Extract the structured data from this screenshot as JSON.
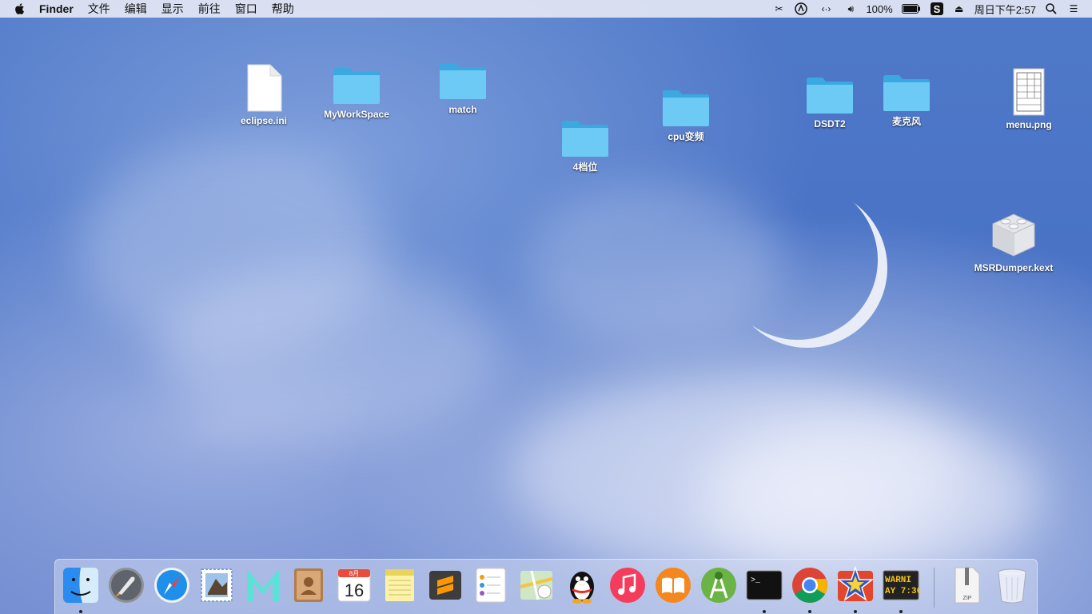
{
  "menubar": {
    "app_name": "Finder",
    "menus": [
      "文件",
      "编辑",
      "显示",
      "前往",
      "窗口",
      "帮助"
    ],
    "battery_percent": "100%",
    "datetime": "周日下午2:57",
    "status_icons": [
      "scissors-icon",
      "adobe-icon",
      "network-arrows-icon",
      "volume-icon",
      "battery-icon",
      "sogou-input-icon",
      "eject-icon",
      "spotlight-search-icon",
      "notification-center-icon"
    ]
  },
  "desktop": {
    "icons": [
      {
        "name": "eclipse.ini",
        "kind": "document"
      },
      {
        "name": "MyWorkSpace",
        "kind": "folder"
      },
      {
        "name": "match",
        "kind": "folder"
      },
      {
        "name": "4档位",
        "kind": "folder"
      },
      {
        "name": "cpu变频",
        "kind": "folder"
      },
      {
        "name": "DSDT2",
        "kind": "folder"
      },
      {
        "name": "麦克风",
        "kind": "folder"
      },
      {
        "name": "menu.png",
        "kind": "image"
      },
      {
        "name": "MSRDumper.kext",
        "kind": "kext"
      }
    ]
  },
  "dock": {
    "apps": [
      {
        "name": "Finder",
        "icon": "finder-icon",
        "running": true
      },
      {
        "name": "Launchpad",
        "icon": "rocket-icon",
        "running": false
      },
      {
        "name": "Safari",
        "icon": "compass-icon",
        "running": false
      },
      {
        "name": "Mail",
        "icon": "mail-stamp-icon",
        "running": false
      },
      {
        "name": "MWeb",
        "icon": "m-letter-icon",
        "running": false
      },
      {
        "name": "Contacts",
        "icon": "contacts-book-icon",
        "running": false
      },
      {
        "name": "Calendar",
        "icon": "calendar-icon",
        "running": false
      },
      {
        "name": "Notes",
        "icon": "notes-icon",
        "running": false
      },
      {
        "name": "Sublime Text",
        "icon": "sublime-icon",
        "running": false
      },
      {
        "name": "Reminders",
        "icon": "reminders-icon",
        "running": false
      },
      {
        "name": "Maps",
        "icon": "map-icon",
        "running": false
      },
      {
        "name": "QQ",
        "icon": "penguin-icon",
        "running": false
      },
      {
        "name": "iTunes",
        "icon": "music-note-icon",
        "running": false
      },
      {
        "name": "iBooks",
        "icon": "book-icon",
        "running": false
      },
      {
        "name": "Android Studio",
        "icon": "android-studio-icon",
        "running": false
      },
      {
        "name": "Terminal",
        "icon": "terminal-icon",
        "running": true
      },
      {
        "name": "Chrome",
        "icon": "chrome-icon",
        "running": true
      },
      {
        "name": "Star App",
        "icon": "star-app-icon",
        "running": true
      },
      {
        "name": "Console",
        "icon": "console-icon",
        "running": true
      }
    ],
    "calendar_month": "8月",
    "calendar_day": "16",
    "console_text_1": "WARNI",
    "console_text_2": "AY 7:36",
    "terminal_prompt": ">_",
    "zip_label": "ZIP"
  }
}
